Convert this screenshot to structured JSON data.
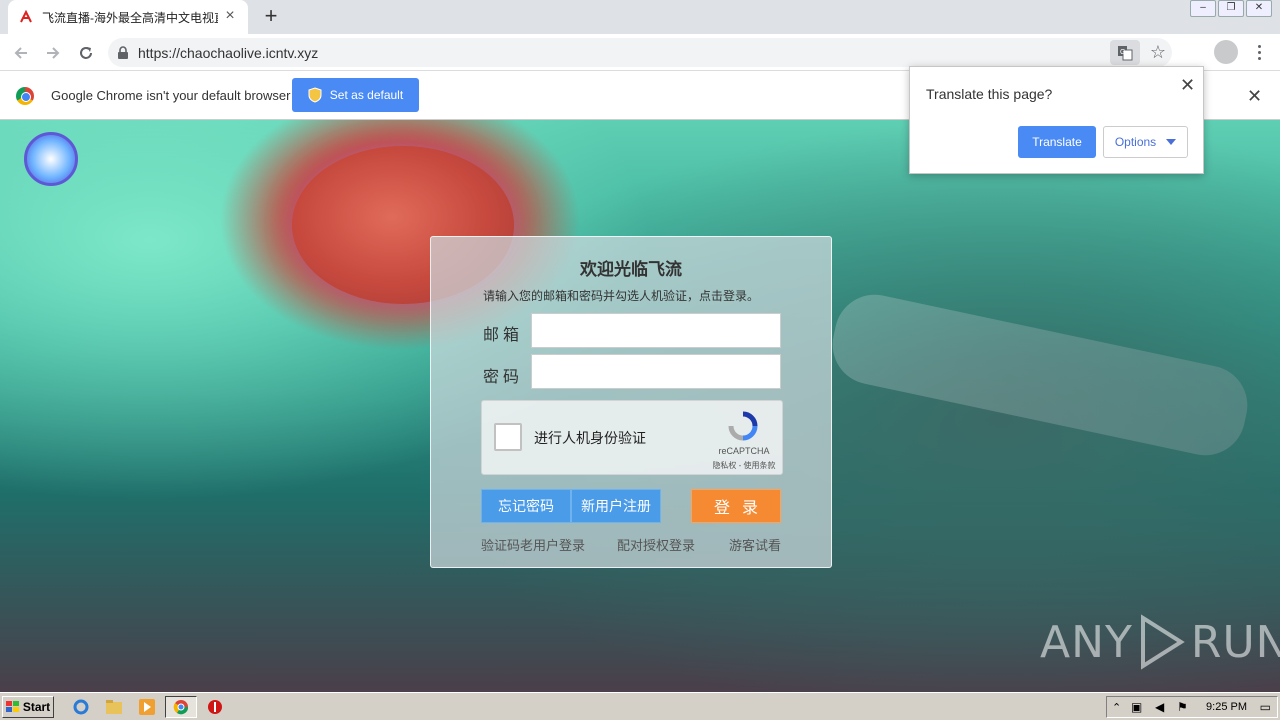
{
  "browser": {
    "tab_title": "飞流直播-海外最全高清中文电视直播",
    "url": "https://chaochaolive.icntv.xyz"
  },
  "infobar": {
    "message": "Google Chrome isn't your default browser",
    "set_default_label": "Set as default"
  },
  "translate_bubble": {
    "title": "Translate this page?",
    "translate_label": "Translate",
    "options_label": "Options"
  },
  "login": {
    "title": "欢迎光临飞流",
    "hint": "请输入您的邮箱和密码并勾选人机验证，点击登录。",
    "email_label": "邮箱",
    "password_label": "密码",
    "email_value": "",
    "password_value": "",
    "recaptcha_label": "进行人机身份验证",
    "recaptcha_brand": "reCAPTCHA",
    "recaptcha_links": "隐私权 - 使用条款",
    "forgot_label": "忘记密码",
    "register_label": "新用户注册",
    "login_label": "登录",
    "links": [
      "验证码老用户登录",
      "配对授权登录",
      "游客试看"
    ]
  },
  "watermark": {
    "left": "ANY",
    "right": "RUN"
  },
  "taskbar": {
    "start_label": "Start",
    "clock": "9:25 PM"
  },
  "colors": {
    "chrome_blue": "#4a8af4",
    "login_blue": "#4a9be8",
    "login_orange": "#f58a33"
  }
}
